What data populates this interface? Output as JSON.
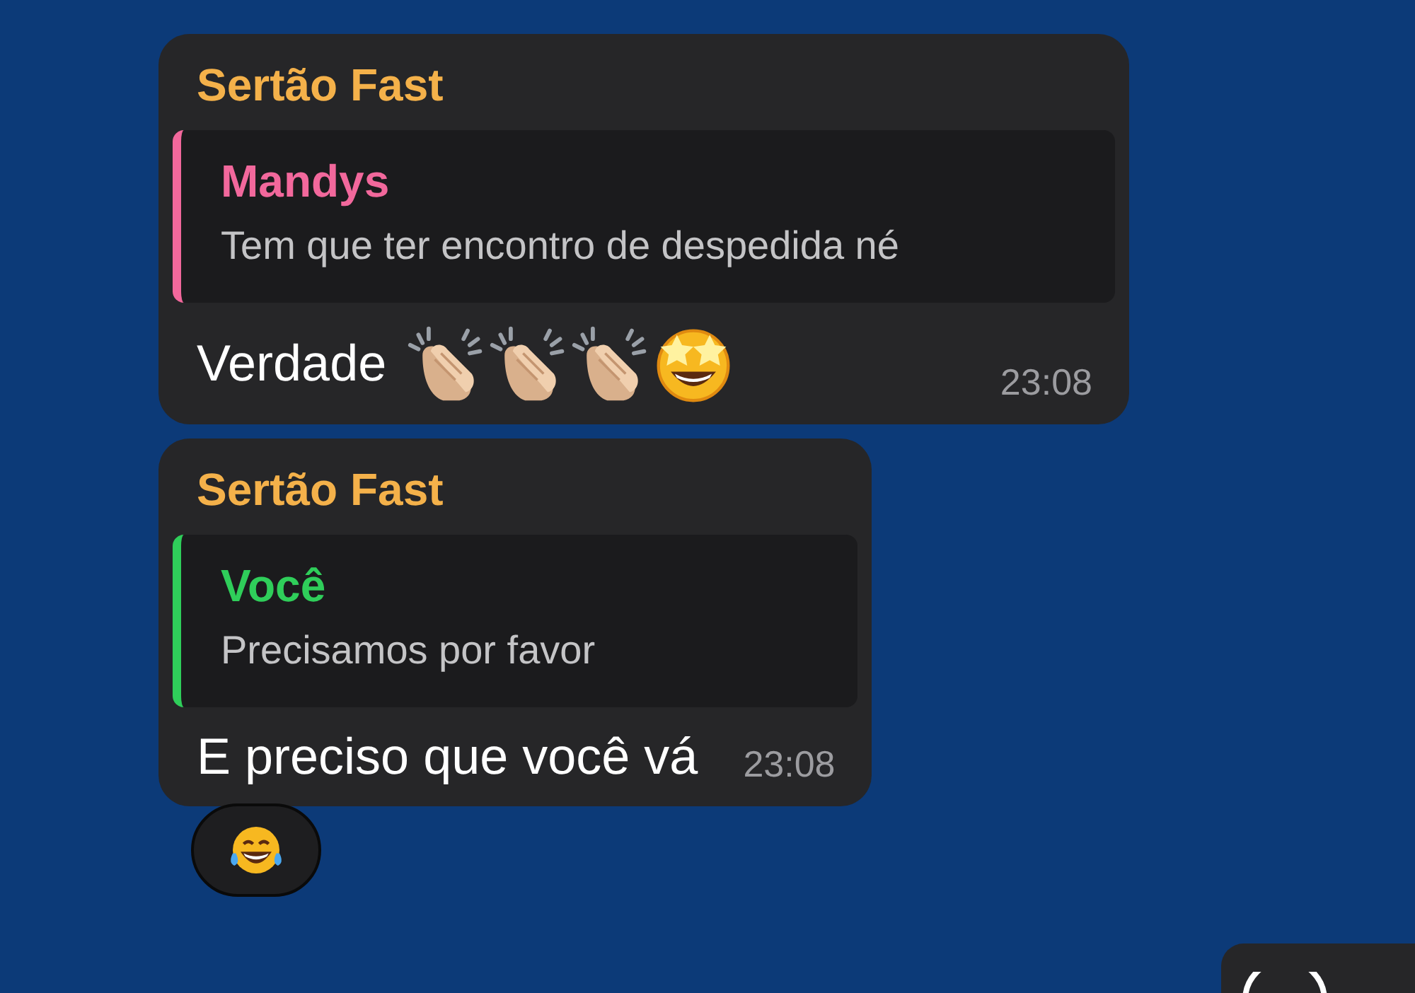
{
  "messages": [
    {
      "sender": "Sertão Fast",
      "quote": {
        "author": "Mandys",
        "text": "Tem que ter encontro de despedida né",
        "color": "#f2689c"
      },
      "text": "Verdade",
      "emojis": [
        {
          "kind": "clap"
        },
        {
          "kind": "clap"
        },
        {
          "kind": "clap"
        },
        {
          "kind": "star-eyes"
        }
      ],
      "time": "23:08"
    },
    {
      "sender": "Sertão Fast",
      "quote": {
        "author": "Você",
        "text": "Precisamos por favor",
        "color": "#2fce5a"
      },
      "text": "E preciso que você vá",
      "time": "23:08",
      "reaction": {
        "kind": "laugh"
      }
    }
  ]
}
